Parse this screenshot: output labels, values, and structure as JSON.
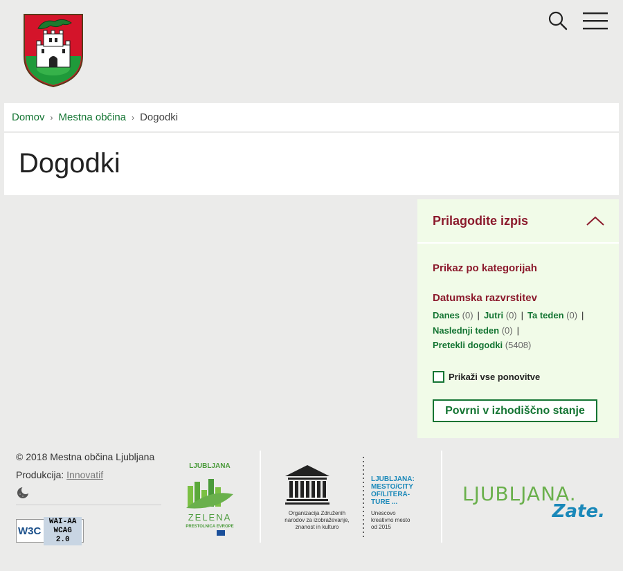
{
  "header": {
    "logo_icon": "ljubljana-coat-of-arms-icon",
    "search_icon": "search-icon",
    "menu_icon": "hamburger-menu-icon"
  },
  "breadcrumb": {
    "items": [
      {
        "label": "Domov"
      },
      {
        "label": "Mestna občina"
      }
    ],
    "current": "Dogodki"
  },
  "page": {
    "title": "Dogodki"
  },
  "filter": {
    "title": "Prilagodite izpis",
    "toggle_icon": "chevron-up-icon",
    "categories_label": "Prikaz po kategorijah",
    "dates_label": "Datumska razvrstitev",
    "dates": [
      {
        "label": "Danes",
        "count": "(0)"
      },
      {
        "label": "Jutri",
        "count": "(0)"
      },
      {
        "label": "Ta teden",
        "count": "(0)"
      },
      {
        "label": "Naslednji teden",
        "count": "(0)"
      },
      {
        "label": "Pretekli dogodki",
        "count": "(5408)"
      }
    ],
    "show_repeats": "Prikaži vse ponovitve",
    "reset_button": "Povrni v izhodiščno stanje"
  },
  "footer": {
    "copyright": "© 2018 Mestna občina Ljubljana",
    "production_label": "Produkcija:",
    "production_link": "Innovatif",
    "contrast_icon": "moon-contrast-icon",
    "wcag": {
      "w3c": "W3C",
      "line1": "WAI-AA",
      "line2": "WCAG 2.0"
    },
    "green_capital": {
      "line1": "LJUBLJANA",
      "line2": "Zelena prestolnica Evrope",
      "line3": "ZELENA",
      "line4": "PRESTOLNICA EVROPE"
    },
    "unesco": {
      "name": "UNESCO",
      "caption": [
        "Organizacija Združenih",
        "narodov za izobraževanje,",
        "znanost in kulturo"
      ],
      "city_title": [
        "LJUBLJANA:",
        "MESTO/CITY",
        "OF/LITERA-",
        "TURE ..."
      ],
      "city_caption": [
        "Unescovo",
        "kreativno mesto",
        "od 2015"
      ]
    },
    "brand": {
      "line1": "LJUBLJANA.",
      "line2": "Zate."
    }
  },
  "colors": {
    "link_green": "#137432",
    "accent_red": "#8b1a2c",
    "filter_bg": "#f1fbe8",
    "page_bg": "#ebebea"
  }
}
